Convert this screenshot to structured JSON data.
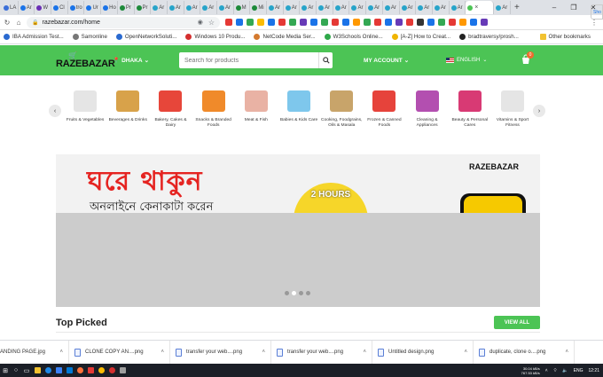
{
  "browser": {
    "tabs": [
      {
        "label": "LA",
        "color": "#3b6fd8"
      },
      {
        "label": "Ar",
        "color": "#1a73e8"
      },
      {
        "label": "W",
        "color": "#6a2fb5"
      },
      {
        "label": "Cl",
        "color": "#1a73e8"
      },
      {
        "label": "tro",
        "color": "#1a73e8"
      },
      {
        "label": "Ur",
        "color": "#1a73e8"
      },
      {
        "label": "Ho",
        "color": "#1a73e8"
      },
      {
        "label": "Pr",
        "color": "#1d8a3a"
      },
      {
        "label": "Pr",
        "color": "#1d8a3a"
      },
      {
        "label": "Ar",
        "color": "#27a4c9"
      },
      {
        "label": "Ar",
        "color": "#27a4c9"
      },
      {
        "label": "Ar",
        "color": "#27a4c9"
      },
      {
        "label": "Ar",
        "color": "#27a4c9"
      },
      {
        "label": "Ar",
        "color": "#27a4c9"
      },
      {
        "label": "M",
        "color": "#1d8a3a"
      },
      {
        "label": "Mi",
        "color": "#1d8a3a"
      },
      {
        "label": "Ar",
        "color": "#27a4c9"
      },
      {
        "label": "Ar",
        "color": "#27a4c9"
      },
      {
        "label": "Ar",
        "color": "#27a4c9"
      },
      {
        "label": "Ar",
        "color": "#27a4c9"
      },
      {
        "label": "Ar",
        "color": "#27a4c9"
      },
      {
        "label": "Ar",
        "color": "#27a4c9"
      },
      {
        "label": "Ar",
        "color": "#27a4c9"
      },
      {
        "label": "Ar",
        "color": "#27a4c9"
      },
      {
        "label": "Ar",
        "color": "#27a4c9"
      },
      {
        "label": "Ar",
        "color": "#27a4c9"
      },
      {
        "label": "Ar",
        "color": "#27a4c9"
      },
      {
        "label": "Ar",
        "color": "#27a4c9"
      },
      {
        "label": "Ar",
        "color": "#27a4c9"
      }
    ],
    "active_tab_close": "×",
    "new_tab": "+",
    "window_controls": [
      "–",
      "❐",
      "✕"
    ],
    "url": "razebazar.com/home",
    "menu": "⋮"
  },
  "bookmarks": [
    {
      "label": "IBA Admission Test...",
      "color": "#2a6ad0"
    },
    {
      "label": "Samonline",
      "color": "#777"
    },
    {
      "label": "OpenNetworkSoluti...",
      "color": "#2a6ad0"
    },
    {
      "label": "Windows 10 Produ...",
      "color": "#d42f2f"
    },
    {
      "label": "NetCode Media Ser...",
      "color": "#d47a2f"
    },
    {
      "label": "W3Schools Online...",
      "color": "#2fa84a"
    },
    {
      "label": "[A-Z] How to Creat...",
      "color": "#f0b400"
    },
    {
      "label": "bradtraversy/prosh...",
      "color": "#222"
    }
  ],
  "other_bookmarks": "Other bookmarks",
  "header": {
    "logo": "RAZEBAZAR",
    "location": "DHAKA",
    "search_placeholder": "Search for products",
    "account": "MY ACCOUNT",
    "language": "ENGLISH",
    "cart_count": "0"
  },
  "categories": [
    {
      "name": "Fruits & Vegetables",
      "color": "#e5e5e5"
    },
    {
      "name": "Beverages & Drinks",
      "color": "#d8a24a"
    },
    {
      "name": "Bakery, Cakes & Dairy",
      "color": "#e7463a"
    },
    {
      "name": "Snacks & Branded Foods",
      "color": "#f08a2a"
    },
    {
      "name": "Meat & Fish",
      "color": "#e9b2a4"
    },
    {
      "name": "Babies & Kids Care",
      "color": "#7ec7ec"
    },
    {
      "name": "Cooking, Foodgrains, Oils & Masala",
      "color": "#c8a46a"
    },
    {
      "name": "Frozen & Canned Foods",
      "color": "#e6433b"
    },
    {
      "name": "Cleaning & Appliances",
      "color": "#b34fb0"
    },
    {
      "name": "Beauty & Personal Cares",
      "color": "#d83a74"
    },
    {
      "name": "Vitamins & Sport Fitness",
      "color": "#e5e5e5"
    }
  ],
  "banner": {
    "headline": "ঘরে থাকুন",
    "subline": "অনলাইনে কেনাকাটা করেন",
    "logo": "RAZEBAZAR",
    "badge": "2 HOURS",
    "slides": 4,
    "active_slide": 1
  },
  "top_picked": {
    "title": "Top Picked",
    "view_all": "VIEW ALL"
  },
  "downloads": {
    "items": [
      "ANDING PAGE.jpg",
      "CLONE COPY AN....png",
      "transfer your web....png",
      "transfer your web....png",
      "Untitled design.png",
      "duplicate, clone o....png"
    ],
    "show_all": "Sho"
  },
  "taskbar": {
    "net_up": "30.04 kB/s",
    "net_down": "767.53 kB/s",
    "lang": "ENG",
    "time": "12:21"
  }
}
